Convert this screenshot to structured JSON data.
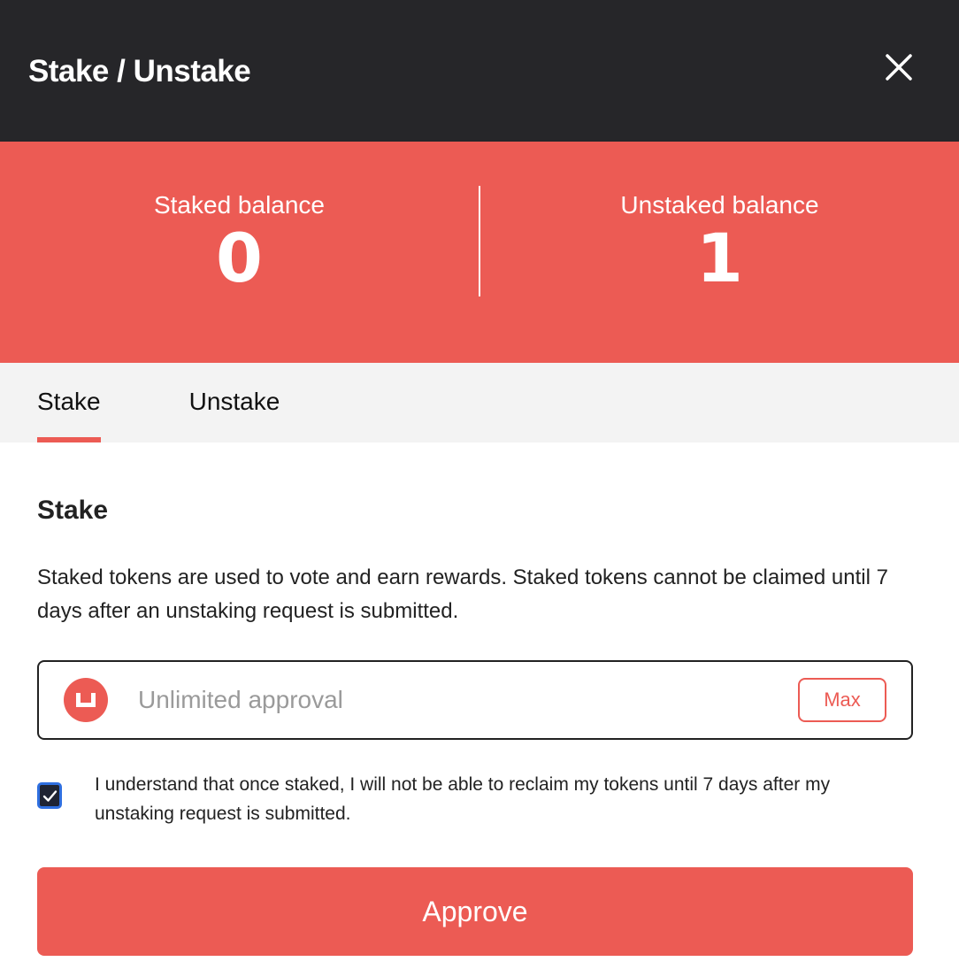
{
  "modal": {
    "title": "Stake / Unstake",
    "close_icon": "close-icon"
  },
  "balances": {
    "staked_label": "Staked balance",
    "staked_value": "0",
    "unstaked_label": "Unstaked balance",
    "unstaked_value": "1"
  },
  "tabs": [
    {
      "label": "Stake",
      "active": true
    },
    {
      "label": "Unstake",
      "active": false
    }
  ],
  "stake": {
    "heading": "Stake",
    "description": "Staked tokens are used to vote and earn rewards. Staked tokens cannot be claimed until 7 days after an unstaking request is submitted.",
    "amount_placeholder": "Unlimited approval",
    "amount_value": "",
    "token_icon": "token-logo-icon",
    "max_label": "Max",
    "consent_checked": true,
    "consent_text": "I understand that once staked, I will not be able to reclaim my tokens until 7 days after my unstaking request is submitted.",
    "approve_label": "Approve"
  },
  "colors": {
    "header_bg": "#262629",
    "accent": "#ec5b54",
    "tab_bar_bg": "#f3f3f3",
    "checkbox_focus": "#2f6fe0"
  }
}
